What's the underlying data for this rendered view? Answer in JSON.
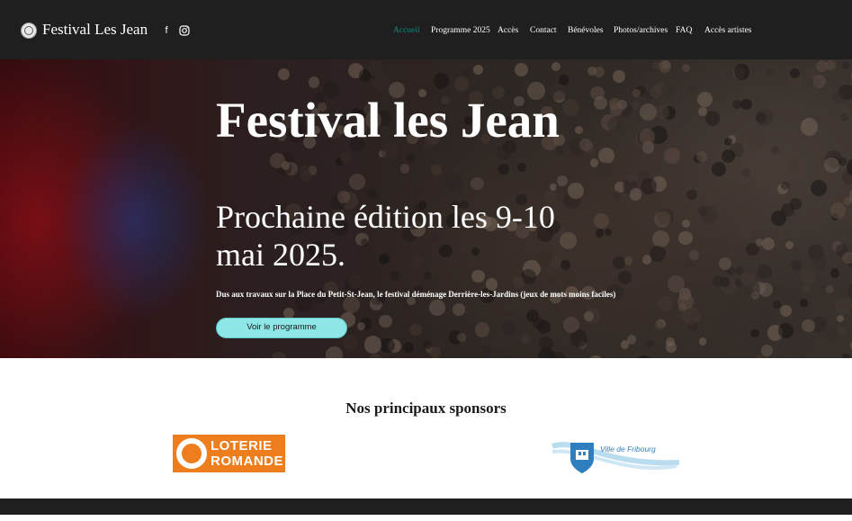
{
  "header": {
    "site_title": "Festival Les Jean",
    "social": [
      {
        "name": "facebook-icon",
        "glyph": "f"
      },
      {
        "name": "instagram-icon",
        "glyph": "◎"
      }
    ],
    "nav": [
      {
        "label": "Accueil",
        "active": true
      },
      {
        "label": "Programme 2025",
        "active": false
      },
      {
        "label": "Accès",
        "active": false
      },
      {
        "label": "Contact",
        "active": false
      },
      {
        "label": "Bénévoles",
        "active": false
      },
      {
        "label": "Photos/archives",
        "active": false
      },
      {
        "label": "FAQ",
        "active": false
      },
      {
        "label": "Accès artistes",
        "active": false
      }
    ],
    "colors": {
      "background": "#1f1f1f",
      "active_link": "#17847c",
      "link": "#ffffff"
    }
  },
  "hero": {
    "title": "Festival les Jean",
    "subtitle": "Prochaine édition les 9-10 mai 2025.",
    "note": "Dus aux travaux sur la Place du Petit-St-Jean, le festival déménage Derrière-les-Jardins (jeux de mots moins faciles)",
    "cta_label": "Voir le programme",
    "cta_color": "#8ee6e6"
  },
  "sponsors": {
    "heading": "Nos principaux sponsors",
    "items": [
      {
        "name": "loterie-romande-logo",
        "lines": [
          "LOTERIE",
          "ROMANDE"
        ],
        "color": "#ee7d1e"
      },
      {
        "name": "ville-de-fribourg-logo",
        "text": "Ville de Fribourg",
        "color": "#2f7fc0"
      }
    ]
  }
}
